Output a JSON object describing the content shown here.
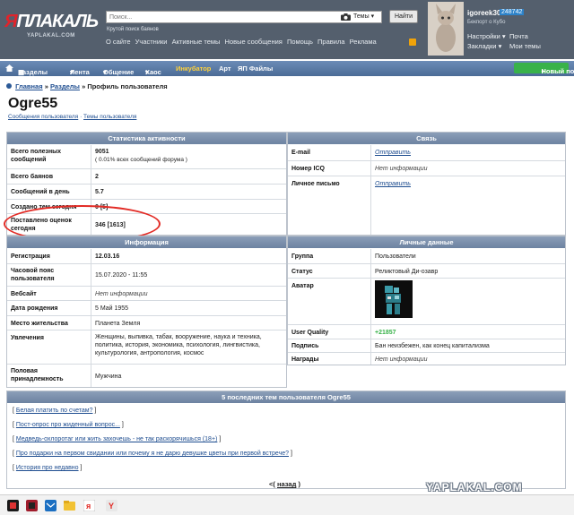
{
  "header": {
    "logo_main": "ЯПЛАКАЛЬ",
    "logo_sub": "YAPLAKAL.COM",
    "search_placeholder": "Поиск...",
    "search_scope": "Темы",
    "find_label": "Найти",
    "tagline": "Крутой поиск баянов",
    "links": [
      "О сайте",
      "Участники",
      "Активные темы",
      "Новые сообщения",
      "Помощь",
      "Правила",
      "Реклама"
    ],
    "user": {
      "name": "igoreek30",
      "points": "248742",
      "subtitle": "Бекпорт о Кубо",
      "settings": "Настройки",
      "mail": "Почта",
      "bookmarks": "Закладки",
      "my_topics": "Мои темы"
    }
  },
  "nav": {
    "items": [
      "Разделы",
      "Лента",
      "Общение",
      "Хаос",
      "Инкубатор",
      "Арт",
      "ЯП Файлы"
    ],
    "new_post": "Новый пост"
  },
  "breadcrumb": {
    "home": "Главная",
    "sections": "Разделы",
    "current": "Профиль пользователя",
    "sep": "»"
  },
  "profile": {
    "title": "Ogre55",
    "link_messages": "Сообщения пользователя",
    "sep": "·",
    "link_topics": "Темы пользователя"
  },
  "stats": {
    "header": "Статистика активности",
    "rows": [
      {
        "label": "Всего полезных сообщений",
        "value": "9051",
        "note": "( 0.01% всех сообщений форума )"
      },
      {
        "label": "Всего баянов",
        "value": "2"
      },
      {
        "label": "Сообщений в день",
        "value": "5.7"
      },
      {
        "label": "Создано тем сегодня",
        "value": "0 [5]"
      },
      {
        "label": "Поставлено оценок сегодня",
        "value": "346 [1613]"
      }
    ]
  },
  "contact": {
    "header": "Связь",
    "rows": [
      {
        "label": "E-mail",
        "value": "Отправить"
      },
      {
        "label": "Номер ICQ",
        "value": "Нет информации"
      },
      {
        "label": "Личное письмо",
        "value": "Отправить"
      }
    ]
  },
  "info": {
    "header": "Информация",
    "rows": [
      {
        "label": "Регистрация",
        "value": "12.03.16"
      },
      {
        "label": "Часовой пояс пользователя",
        "value": "15.07.2020 - 11:55"
      },
      {
        "label": "Вебсайт",
        "value": "Нет информации"
      },
      {
        "label": "Дата рождения",
        "value": "5 Май 1955"
      },
      {
        "label": "Место жительства",
        "value": "Планета Земля"
      },
      {
        "label": "Увлечения",
        "value": "Женщины, выпивка, табак, вооружение, наука и техника, политика, история, экономика, психология, лингвистика, культурология, антропология, космос"
      },
      {
        "label": "Половая принадлежность",
        "value": "Мужчина"
      }
    ]
  },
  "personal": {
    "header": "Личные данные",
    "rows": [
      {
        "label": "Группа",
        "value": "Пользователи"
      },
      {
        "label": "Статус",
        "value": "Реликтовый Ди-озавр"
      },
      {
        "label": "Аватар",
        "value": ""
      },
      {
        "label": "User Quality",
        "value": "21857"
      },
      {
        "label": "Подпись",
        "value": "Бан неизбежен, как конец капитализма"
      },
      {
        "label": "Награды",
        "value": "Нет информации"
      }
    ]
  },
  "topics": {
    "header": "5 последних тем пользователя Ogre55",
    "items": [
      "Белая платить по счетам?",
      "Пост-опрос про жиденный вопрос...",
      "Медведь-охлоротаг или жить захочешь - не так раскорячишься (18+)",
      "Про подарки на первом свидании или почему я не дарю девушке цветы при первой встрече?",
      "История про недавно"
    ],
    "pager_prefix": "<(",
    "pager_label": "назад",
    "pager_suffix": ")"
  },
  "watermark": "YAPLAKAL.COM",
  "taskbar": [
    "media-icon",
    "app-icon",
    "mail-icon",
    "files-icon",
    "yandex-icon",
    "browser-icon"
  ],
  "colors": {
    "header_bg": "#545f6d",
    "nav_bg": "#5b7ba6",
    "panel_header": "#7d91ae",
    "link": "#1d4c8f",
    "highlight": "#e22b25",
    "new_post": "#39b24a"
  }
}
